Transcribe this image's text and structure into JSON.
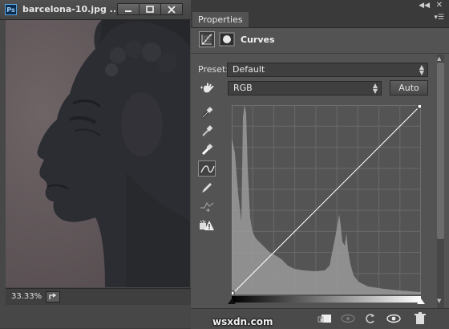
{
  "document": {
    "app_logo": "Ps",
    "title": "barcelona-10.jpg ...",
    "zoom": "33.33%"
  },
  "panel": {
    "tab": "Properties",
    "adjustment_title": "Curves",
    "preset_label": "Preset:",
    "preset_value": "Default",
    "channel_value": "RGB",
    "auto_label": "Auto"
  },
  "icons": {
    "collapse": "double-chevron-left-icon",
    "close": "close-icon",
    "panel_menu": "panel-menu-icon",
    "tools": [
      "target-adjust-hand-icon",
      "sample-black-point-eyedropper-icon",
      "sample-gray-point-eyedropper-icon",
      "sample-white-point-eyedropper-icon",
      "curve-points-icon",
      "pencil-draw-icon",
      "smooth-curve-icon",
      "clipping-warning-icon"
    ],
    "footer": [
      "clip-to-layer-icon",
      "view-previous-state-icon",
      "reset-icon",
      "visibility-eye-icon",
      "trash-icon"
    ]
  },
  "watermark": "wsxdn.com"
}
